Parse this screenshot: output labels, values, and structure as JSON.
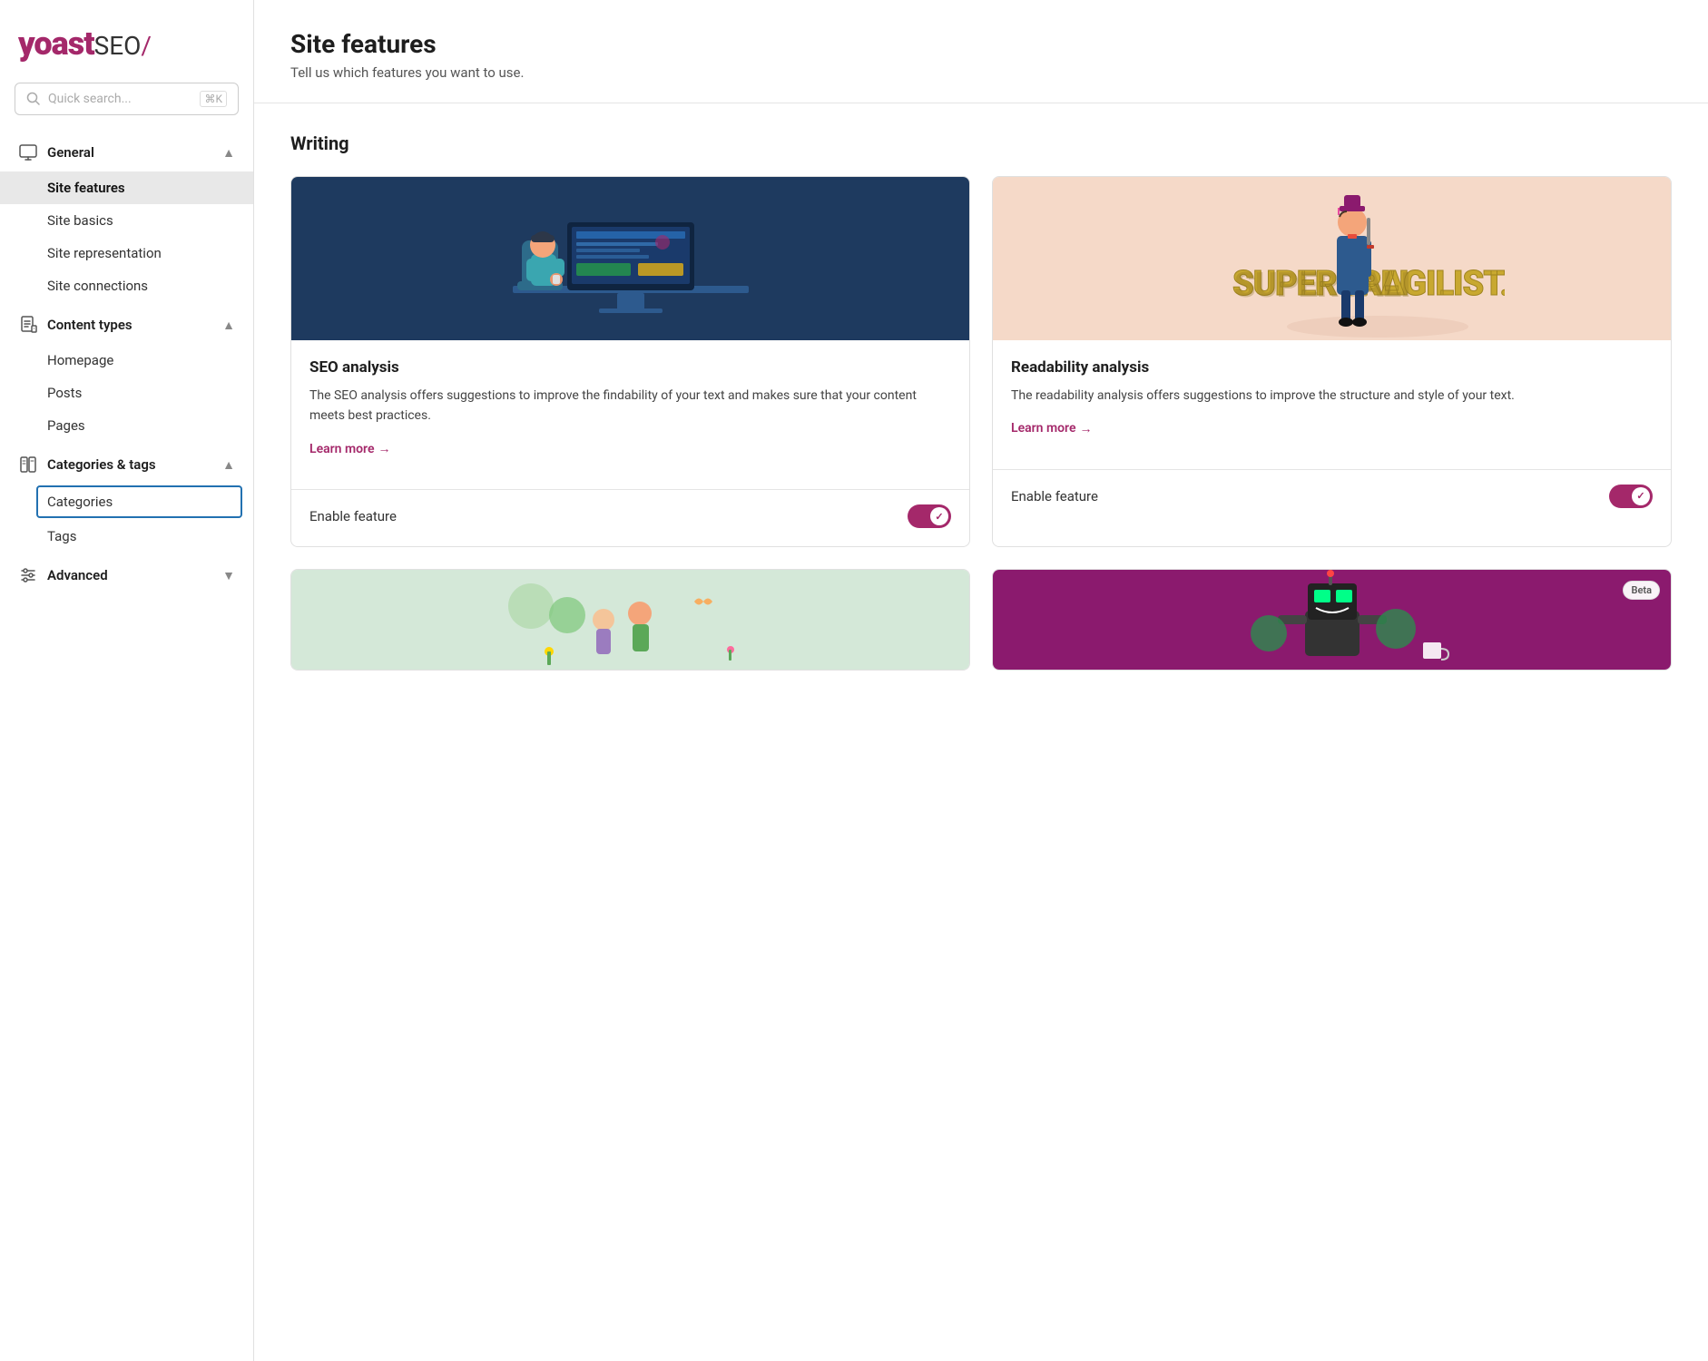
{
  "logo": {
    "yoast": "yoast",
    "seo": "SEO",
    "slash": "/"
  },
  "search": {
    "placeholder": "Quick search...",
    "shortcut": "⌘K"
  },
  "sidebar": {
    "sections": [
      {
        "id": "general",
        "label": "General",
        "icon": "monitor-icon",
        "expanded": true,
        "items": [
          {
            "id": "site-features",
            "label": "Site features",
            "active": true
          },
          {
            "id": "site-basics",
            "label": "Site basics",
            "active": false
          },
          {
            "id": "site-representation",
            "label": "Site representation",
            "active": false
          },
          {
            "id": "site-connections",
            "label": "Site connections",
            "active": false
          }
        ]
      },
      {
        "id": "content-types",
        "label": "Content types",
        "icon": "document-icon",
        "expanded": true,
        "items": [
          {
            "id": "homepage",
            "label": "Homepage",
            "active": false
          },
          {
            "id": "posts",
            "label": "Posts",
            "active": false
          },
          {
            "id": "pages",
            "label": "Pages",
            "active": false
          }
        ]
      },
      {
        "id": "categories-tags",
        "label": "Categories & tags",
        "icon": "tag-icon",
        "expanded": true,
        "items": [
          {
            "id": "categories",
            "label": "Categories",
            "active": false,
            "selected": true
          },
          {
            "id": "tags",
            "label": "Tags",
            "active": false
          }
        ]
      },
      {
        "id": "advanced",
        "label": "Advanced",
        "icon": "sliders-icon",
        "expanded": false,
        "items": []
      }
    ]
  },
  "page": {
    "title": "Site features",
    "subtitle": "Tell us which features you want to use."
  },
  "writing_section": {
    "title": "Writing",
    "cards": [
      {
        "id": "seo-analysis",
        "title": "SEO analysis",
        "description": "The SEO analysis offers suggestions to improve the findability of your text and makes sure that your content meets best practices.",
        "learn_more": "Learn more",
        "learn_more_arrow": "→",
        "enable_label": "Enable feature",
        "enabled": true,
        "image_type": "seo"
      },
      {
        "id": "readability-analysis",
        "title": "Readability analysis",
        "description": "The readability analysis offers suggestions to improve the structure and style of your text.",
        "learn_more": "Learn more",
        "learn_more_arrow": "→",
        "enable_label": "Enable feature",
        "enabled": true,
        "image_type": "readability"
      }
    ]
  },
  "bottom_cards": [
    {
      "id": "card-bottom-left",
      "image_type": "garden",
      "beta": false
    },
    {
      "id": "card-bottom-right",
      "image_type": "robot",
      "beta": true,
      "beta_label": "Beta"
    }
  ]
}
